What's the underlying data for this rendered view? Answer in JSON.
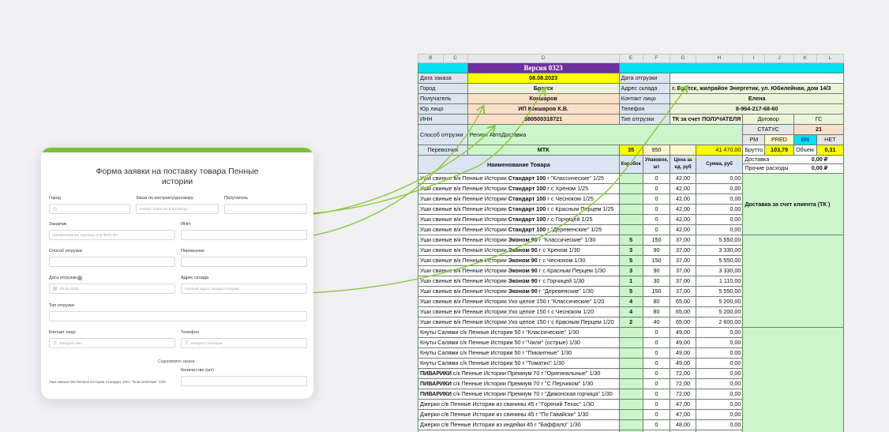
{
  "form": {
    "title": "Форма заявки на поставку товара Пенные истории",
    "fields": {
      "city": {
        "label": "Город",
        "placeholder": ""
      },
      "contract": {
        "label": "Заказ по контракту/договору",
        "placeholder": "Номер точки вы в договоре"
      },
      "recipient": {
        "label": "Получатель",
        "placeholder": ""
      },
      "customer": {
        "label": "Заказчик",
        "placeholder": "Наименование Юрлица или ФИО ИП"
      },
      "inn": {
        "label": "ИНН",
        "placeholder": ""
      },
      "ship_method": {
        "label": "Способ отгрузки",
        "placeholder": ""
      },
      "carrier": {
        "label": "Перевозчик",
        "placeholder": ""
      },
      "ship_date": {
        "label": "Дата отгрузки",
        "placeholder": "30.05.2022",
        "help": "?"
      },
      "warehouse": {
        "label": "Адрес склада",
        "placeholder": "Полный адрес склада отгрузки"
      },
      "ship_type": {
        "label": "Тип отгрузки",
        "placeholder": ""
      },
      "contact": {
        "label": "Контакт лицо",
        "placeholder": "Введите имя"
      },
      "phone": {
        "label": "Телефон",
        "placeholder": "Введите телефон"
      }
    },
    "order_section": "Содержимое заказа",
    "qty_label": "Количество (шт)",
    "product_line": "Уши свиные в/к Пенные Истории Стандарт 100 г \"Классические\" 1/25"
  },
  "sheet": {
    "columns": [
      "B",
      "C",
      "D",
      "E",
      "F",
      "G",
      "H",
      "I",
      "J",
      "K",
      "L"
    ],
    "version": "Версия 0323",
    "order_date_label": "Дата заказа",
    "order_date": "08.08.2023",
    "ship_date_label": "Дата отгрузки",
    "city_label": "Город",
    "city": "Братск",
    "warehouse_label": "Адрес склада",
    "warehouse": "г. Братск, жилрайон Энергетик, ул. Юбилейная, дом 14/3",
    "recipient_label": "Получатель",
    "recipient": "Кокшаров",
    "contact_label": "Контакт лицо",
    "contact": "Елена",
    "legal_label": "Юр лицо",
    "legal": "ИП Кокшаров К.В.",
    "phone_label": "Телефон",
    "phone": "8-964-217-68-60",
    "inn_label": "ИНН",
    "inn": "380500318721",
    "ship_type_label": "Тип отгрузки",
    "ship_type": "ТК за счет ПОЛУЧАТЕЛЯ",
    "contract_label": "Договор",
    "contract": "ГС",
    "method_label": "Способ отгрузки",
    "method": "Регион АвтоДоставка",
    "status_label": "СТАТУС",
    "status": "21",
    "pm": "PM",
    "pred": "PRED",
    "bn": "BN",
    "net": "НЕТ",
    "carrier_label": "Перевозчик",
    "carrier": "МТК",
    "tot_boxes": "35",
    "tot_units": "950",
    "tot_sum": "41 470,00",
    "brutto_label": "Брутто",
    "brutto": "103,79",
    "volume_label": "Объем",
    "volume": "0,31",
    "delivery_label": "Доставка",
    "delivery": "0,00 ₽",
    "other_label": "Прочие расходы",
    "other": "0,00 ₽",
    "col_name": "Наименование Товара",
    "col_boxes": "Коробок",
    "col_pack": "Упаковок, шт",
    "col_price": "Цена за ед. руб",
    "col_sum": "Сумма, руб",
    "delivery_note": "Доставка за счет клиента (ТК )",
    "rows": [
      {
        "pre": "Уши свиные в/к Пенные Истории ",
        "bold": "Стандарт 100",
        "post": " г \"Классические\" 1/25",
        "boxes": "",
        "pack": "0",
        "price": "42,00",
        "sum": "0,00"
      },
      {
        "pre": "Уши свиные в/к Пенные Истории ",
        "bold": "Стандарт 100",
        "post": " г с Хреном 1/25",
        "boxes": "",
        "pack": "0",
        "price": "42,00",
        "sum": "0,00"
      },
      {
        "pre": "Уши свиные в/к Пенные Истории ",
        "bold": "Стандарт 100",
        "post": " г с Чесноком 1/25",
        "boxes": "",
        "pack": "0",
        "price": "42,00",
        "sum": "0,00"
      },
      {
        "pre": "Уши свиные в/к Пенные Истории ",
        "bold": "Стандарт 100",
        "post": " г с Красным Перцем 1/25",
        "boxes": "",
        "pack": "0",
        "price": "42,00",
        "sum": "0,00"
      },
      {
        "pre": "Уши свиные в/к Пенные Истории ",
        "bold": "Стандарт 100",
        "post": " г с Горчицей 1/25",
        "boxes": "",
        "pack": "0",
        "price": "42,00",
        "sum": "0,00"
      },
      {
        "pre": "Уши свиные в/к Пенные Истории ",
        "bold": "Стандарт 100",
        "post": " г \"Деревенские\" 1/25",
        "boxes": "",
        "pack": "0",
        "price": "42,00",
        "sum": "0,00"
      },
      {
        "pre": "Уши свиные в/к Пенные Истории ",
        "bold": "Эконом 90",
        "post": " г \"Классические\" 1/30",
        "boxes": "5",
        "pack": "150",
        "price": "37,00",
        "sum": "5 550,00"
      },
      {
        "pre": "Уши свиные в/к Пенные Истории ",
        "bold": "Эконом 90",
        "post": " г с Хреном 1/30",
        "boxes": "3",
        "pack": "90",
        "price": "37,00",
        "sum": "3 330,00"
      },
      {
        "pre": "Уши свиные в/к Пенные Истории ",
        "bold": "Эконом 90",
        "post": " г с Чесноком 1/30",
        "boxes": "5",
        "pack": "150",
        "price": "37,00",
        "sum": "5 550,00"
      },
      {
        "pre": "Уши свиные в/к Пенные Истории ",
        "bold": "Эконом 90",
        "post": " г с Красным Перцем 1/30",
        "boxes": "3",
        "pack": "90",
        "price": "37,00",
        "sum": "3 330,00"
      },
      {
        "pre": "Уши свиные в/к Пенные Истории ",
        "bold": "Эконом 90",
        "post": " г с Горчицей 1/30",
        "boxes": "1",
        "pack": "30",
        "price": "37,00",
        "sum": "1 110,00"
      },
      {
        "pre": "Уши свиные в/к Пенные Истории ",
        "bold": "Эконом 90",
        "post": " г \"Деревенские\" 1/30",
        "boxes": "5",
        "pack": "150",
        "price": "37,00",
        "sum": "5 550,00"
      },
      {
        "pre": "Уши свиные в/к Пенные Истории Ухо целое 150 г \"Классические\" 1/20",
        "bold": "",
        "post": "",
        "boxes": "4",
        "pack": "80",
        "price": "65,00",
        "sum": "5 200,00"
      },
      {
        "pre": "Уши свиные в/к Пенные Истории Ухо целое 150 г с Чесноком 1/20",
        "bold": "",
        "post": "",
        "boxes": "4",
        "pack": "80",
        "price": "65,00",
        "sum": "5 200,00"
      },
      {
        "pre": "Уши свиные в/к Пенные Истории Ухо целое 150 г с Красным Перцем 1/20",
        "bold": "",
        "post": "",
        "boxes": "2",
        "pack": "40",
        "price": "65,00",
        "sum": "2 600,00"
      },
      {
        "pre": "Кнуты Салями с/к Пенные Истории 50 г \"Классические\" 1/30",
        "bold": "",
        "post": "",
        "boxes": "",
        "pack": "0",
        "price": "49,00",
        "sum": "0,00"
      },
      {
        "pre": "Кнуты Салями с/к Пенные Истории 50 г \"Чили\" (острые) 1/30",
        "bold": "",
        "post": "",
        "boxes": "",
        "pack": "0",
        "price": "49,00",
        "sum": "0,00"
      },
      {
        "pre": "Кнуты Салями с/к Пенные Истории 50 г \"Пикантные\" 1/30",
        "bold": "",
        "post": "",
        "boxes": "",
        "pack": "0",
        "price": "49,00",
        "sum": "0,00"
      },
      {
        "pre": "Кнуты Салями с/к Пенные Истории 50 г \"Томатис\" 1/30",
        "bold": "",
        "post": "",
        "boxes": "",
        "pack": "0",
        "price": "49,00",
        "sum": "0,00"
      },
      {
        "pre": "",
        "bold": "ПИВАРИКИ",
        "post": " с/к Пенные Истории Премиум 70 г \"Оригинальные\" 1/30",
        "boxes": "",
        "pack": "0",
        "price": "72,00",
        "sum": "0,00"
      },
      {
        "pre": "",
        "bold": "ПИВАРИКИ",
        "post": " с/к Пенные Истории Премиум 70 г \"С Перчиком\" 1/30",
        "boxes": "",
        "pack": "0",
        "price": "72,00",
        "sum": "0,00"
      },
      {
        "pre": "",
        "bold": "ПИВАРИКИ",
        "post": " с/к Пенные Истории Премиум 70 г \"Дижонская горчица\" 1/30",
        "boxes": "",
        "pack": "0",
        "price": "72,00",
        "sum": "0,00"
      },
      {
        "pre": "Джерки с/в Пенные Истории из свинины 45 г \"Горячий Техас\" 1/30",
        "bold": "",
        "post": "",
        "boxes": "",
        "pack": "0",
        "price": "47,00",
        "sum": "0,00"
      },
      {
        "pre": "Джерки с/в Пенные Истории из свинины 45 г \"По Гавайски\" 1/30",
        "bold": "",
        "post": "",
        "boxes": "",
        "pack": "0",
        "price": "47,00",
        "sum": "0,00"
      },
      {
        "pre": "Джерки с/в Пенные Истории из индейки 45 г \"Баффало\" 1/30",
        "bold": "",
        "post": "",
        "boxes": "",
        "pack": "0",
        "price": "48,00",
        "sum": "0,00"
      },
      {
        "pre": "Джерки с/в Пенные Истории из индейки 45 г \"Теннесси\" 1/30",
        "bold": "",
        "post": "",
        "boxes": "",
        "pack": "0",
        "price": "48,00",
        "sum": "0,00"
      }
    ]
  },
  "colors": {
    "accent_green": "#7fbf3a",
    "arrow": "#8cc63f",
    "cyan": "#00e1f0",
    "purple": "#7030a0",
    "yellow": "#ffff00",
    "light_green": "#ccf5cc"
  }
}
